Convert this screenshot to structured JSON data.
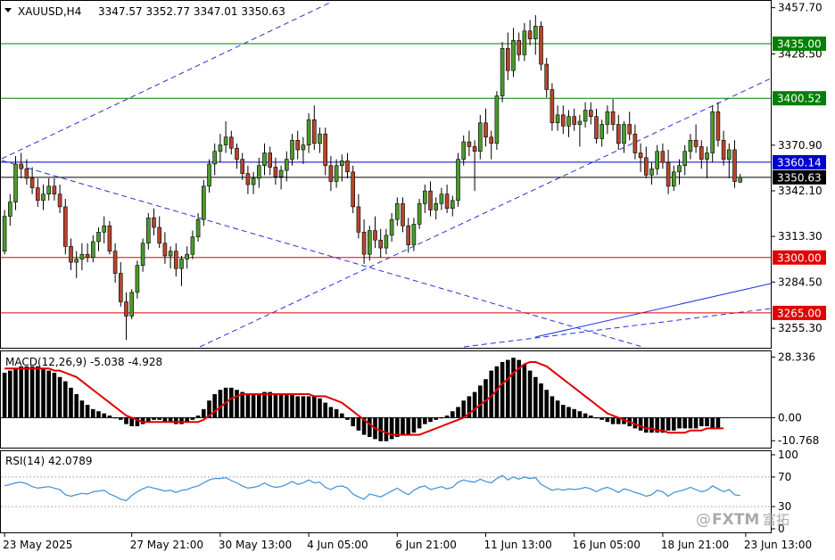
{
  "header": {
    "symbol_label": "XAUUSD,H4",
    "ohlc_label": "3347.57 3352.77 3347.01 3350.63"
  },
  "price_axis": {
    "ticks": [
      "3457.70",
      "3428.50",
      "3370.90",
      "3342.10",
      "3313.30",
      "3284.50",
      "3255.30"
    ],
    "tick_values": [
      3457.7,
      3428.5,
      3370.9,
      3342.1,
      3313.3,
      3284.5,
      3255.3
    ]
  },
  "levels": [
    {
      "label": "3435.00",
      "value": 3435.0,
      "color": "#008000"
    },
    {
      "label": "3400.52",
      "value": 3400.52,
      "color": "#008000"
    },
    {
      "label": "3360.14",
      "value": 3360.14,
      "color": "#0000cc"
    },
    {
      "label": "3350.63",
      "value": 3350.63,
      "color": "#000000"
    },
    {
      "label": "3300.00",
      "value": 3300.0,
      "color": "#e00000"
    },
    {
      "label": "3265.00",
      "value": 3265.0,
      "color": "#e00000"
    }
  ],
  "time_axis": {
    "labels": [
      "23 May 2025",
      "27 May 21:00",
      "30 May 13:00",
      "4 Jun 05:00",
      "6 Jun 21:00",
      "11 Jun 13:00",
      "16 Jun 05:00",
      "18 Jun 21:00",
      "23 Jun 13:00"
    ],
    "bar_index": [
      0,
      23,
      39,
      55,
      71,
      87,
      103,
      119,
      134
    ]
  },
  "macd": {
    "label": "MACD(12,26,9) -5.038 -4.928",
    "ticks": [
      "28.336",
      "0.00",
      "-10.768"
    ],
    "tick_values": [
      28.336,
      0.0,
      -10.768
    ]
  },
  "rsi": {
    "label": "RSI(14) 42.0789",
    "ticks": [
      "100",
      "70",
      "30",
      "0"
    ],
    "tick_values": [
      100,
      70,
      30,
      0
    ]
  },
  "watermark": {
    "text": "FXTM",
    "text_cn": "富拓"
  },
  "colors": {
    "bull": "#4b9a2c",
    "bear": "#b5462c",
    "signal": "#e00000",
    "rsi_line": "#3b8fd6",
    "trendline": "#2233dd"
  },
  "chart_data": {
    "type": "candlestick",
    "title": "XAUUSD,H4",
    "timeframe": "H4",
    "last_ohlc": {
      "open": 3347.57,
      "high": 3352.77,
      "low": 3347.01,
      "close": 3350.63
    },
    "price_range": [
      3243,
      3462
    ],
    "levels": [
      3435.0,
      3400.52,
      3360.14,
      3350.63,
      3300.0,
      3265.0
    ],
    "candles": [
      [
        3304,
        3330,
        3302,
        3326
      ],
      [
        3326,
        3340,
        3320,
        3335
      ],
      [
        3335,
        3364,
        3330,
        3359
      ],
      [
        3359,
        3366,
        3350,
        3356
      ],
      [
        3356,
        3362,
        3346,
        3350
      ],
      [
        3350,
        3357,
        3340,
        3344
      ],
      [
        3344,
        3350,
        3332,
        3336
      ],
      [
        3336,
        3346,
        3330,
        3340
      ],
      [
        3340,
        3350,
        3336,
        3345
      ],
      [
        3345,
        3350,
        3336,
        3340
      ],
      [
        3340,
        3346,
        3328,
        3332
      ],
      [
        3332,
        3337,
        3302,
        3307
      ],
      [
        3307,
        3312,
        3292,
        3297
      ],
      [
        3297,
        3304,
        3287,
        3299
      ],
      [
        3299,
        3309,
        3292,
        3302
      ],
      [
        3302,
        3309,
        3297,
        3300
      ],
      [
        3300,
        3314,
        3297,
        3310
      ],
      [
        3310,
        3319,
        3304,
        3316
      ],
      [
        3316,
        3326,
        3309,
        3320
      ],
      [
        3320,
        3323,
        3302,
        3304
      ],
      [
        3304,
        3309,
        3284,
        3290
      ],
      [
        3290,
        3297,
        3269,
        3272
      ],
      [
        3272,
        3278,
        3248,
        3263
      ],
      [
        3263,
        3280,
        3261,
        3278
      ],
      [
        3278,
        3298,
        3274,
        3295
      ],
      [
        3295,
        3312,
        3291,
        3309
      ],
      [
        3309,
        3328,
        3305,
        3325
      ],
      [
        3325,
        3331,
        3314,
        3319
      ],
      [
        3319,
        3326,
        3306,
        3309
      ],
      [
        3309,
        3316,
        3296,
        3301
      ],
      [
        3301,
        3307,
        3293,
        3304
      ],
      [
        3304,
        3309,
        3288,
        3293
      ],
      [
        3293,
        3301,
        3282,
        3299
      ],
      [
        3299,
        3307,
        3293,
        3302
      ],
      [
        3302,
        3317,
        3299,
        3313
      ],
      [
        3313,
        3328,
        3310,
        3324
      ],
      [
        3324,
        3349,
        3320,
        3345
      ],
      [
        3345,
        3362,
        3341,
        3359
      ],
      [
        3359,
        3372,
        3352,
        3367
      ],
      [
        3367,
        3378,
        3360,
        3371
      ],
      [
        3371,
        3386,
        3366,
        3376
      ],
      [
        3376,
        3380,
        3365,
        3369
      ],
      [
        3369,
        3372,
        3356,
        3362
      ],
      [
        3362,
        3366,
        3349,
        3353
      ],
      [
        3353,
        3358,
        3340,
        3346
      ],
      [
        3346,
        3354,
        3340,
        3350
      ],
      [
        3350,
        3363,
        3344,
        3358
      ],
      [
        3358,
        3372,
        3352,
        3366
      ],
      [
        3366,
        3370,
        3352,
        3357
      ],
      [
        3357,
        3363,
        3346,
        3351
      ],
      [
        3351,
        3358,
        3343,
        3355
      ],
      [
        3355,
        3367,
        3348,
        3362
      ],
      [
        3362,
        3378,
        3358,
        3374
      ],
      [
        3374,
        3380,
        3362,
        3368
      ],
      [
        3368,
        3376,
        3359,
        3371
      ],
      [
        3371,
        3391,
        3366,
        3387
      ],
      [
        3387,
        3396,
        3368,
        3372
      ],
      [
        3372,
        3382,
        3366,
        3378
      ],
      [
        3378,
        3382,
        3352,
        3358
      ],
      [
        3358,
        3364,
        3342,
        3348
      ],
      [
        3348,
        3362,
        3344,
        3358
      ],
      [
        3358,
        3365,
        3348,
        3361
      ],
      [
        3361,
        3366,
        3350,
        3354
      ],
      [
        3354,
        3358,
        3328,
        3332
      ],
      [
        3332,
        3340,
        3312,
        3316
      ],
      [
        3316,
        3324,
        3296,
        3302
      ],
      [
        3302,
        3320,
        3298,
        3317
      ],
      [
        3317,
        3326,
        3306,
        3311
      ],
      [
        3311,
        3318,
        3300,
        3306
      ],
      [
        3306,
        3318,
        3302,
        3314
      ],
      [
        3314,
        3328,
        3310,
        3324
      ],
      [
        3324,
        3338,
        3320,
        3334
      ],
      [
        3334,
        3338,
        3316,
        3320
      ],
      [
        3320,
        3325,
        3303,
        3308
      ],
      [
        3308,
        3325,
        3304,
        3321
      ],
      [
        3321,
        3337,
        3318,
        3334
      ],
      [
        3334,
        3346,
        3328,
        3342
      ],
      [
        3342,
        3348,
        3326,
        3330
      ],
      [
        3330,
        3338,
        3324,
        3334
      ],
      [
        3334,
        3344,
        3330,
        3340
      ],
      [
        3340,
        3346,
        3328,
        3331
      ],
      [
        3331,
        3339,
        3326,
        3336
      ],
      [
        3336,
        3366,
        3332,
        3362
      ],
      [
        3362,
        3377,
        3358,
        3373
      ],
      [
        3373,
        3380,
        3364,
        3370
      ],
      [
        3370,
        3374,
        3342,
        3367
      ],
      [
        3367,
        3390,
        3362,
        3385
      ],
      [
        3385,
        3394,
        3370,
        3376
      ],
      [
        3376,
        3380,
        3362,
        3372
      ],
      [
        3372,
        3405,
        3368,
        3402
      ],
      [
        3402,
        3436,
        3398,
        3432
      ],
      [
        3432,
        3442,
        3412,
        3418
      ],
      [
        3418,
        3445,
        3414,
        3437
      ],
      [
        3437,
        3442,
        3424,
        3428
      ],
      [
        3428,
        3448,
        3424,
        3443
      ],
      [
        3443,
        3450,
        3434,
        3438
      ],
      [
        3438,
        3453,
        3428,
        3446
      ],
      [
        3446,
        3449,
        3418,
        3422
      ],
      [
        3422,
        3426,
        3401,
        3406
      ],
      [
        3406,
        3410,
        3380,
        3385
      ],
      [
        3385,
        3396,
        3380,
        3390
      ],
      [
        3390,
        3396,
        3378,
        3383
      ],
      [
        3383,
        3393,
        3376,
        3389
      ],
      [
        3389,
        3394,
        3380,
        3384
      ],
      [
        3384,
        3390,
        3370,
        3386
      ],
      [
        3386,
        3398,
        3382,
        3393
      ],
      [
        3393,
        3398,
        3384,
        3389
      ],
      [
        3389,
        3394,
        3372,
        3375
      ],
      [
        3375,
        3387,
        3370,
        3384
      ],
      [
        3384,
        3396,
        3378,
        3392
      ],
      [
        3392,
        3400,
        3380,
        3384
      ],
      [
        3384,
        3390,
        3368,
        3372
      ],
      [
        3372,
        3386,
        3366,
        3384
      ],
      [
        3384,
        3392,
        3374,
        3378
      ],
      [
        3378,
        3384,
        3362,
        3366
      ],
      [
        3366,
        3372,
        3354,
        3363
      ],
      [
        3363,
        3370,
        3350,
        3352
      ],
      [
        3352,
        3360,
        3346,
        3356
      ],
      [
        3356,
        3371,
        3352,
        3367
      ],
      [
        3367,
        3372,
        3356,
        3360
      ],
      [
        3360,
        3368,
        3340,
        3345
      ],
      [
        3345,
        3358,
        3342,
        3354
      ],
      [
        3354,
        3362,
        3346,
        3358
      ],
      [
        3358,
        3371,
        3352,
        3367
      ],
      [
        3367,
        3378,
        3362,
        3374
      ],
      [
        3374,
        3384,
        3366,
        3370
      ],
      [
        3370,
        3374,
        3356,
        3362
      ],
      [
        3362,
        3370,
        3350,
        3366
      ],
      [
        3366,
        3396,
        3360,
        3392
      ],
      [
        3392,
        3398,
        3370,
        3374
      ],
      [
        3374,
        3380,
        3358,
        3362
      ],
      [
        3362,
        3372,
        3350,
        3368
      ],
      [
        3368,
        3374,
        3344,
        3348
      ],
      [
        3347.57,
        3352.77,
        3347.01,
        3350.63
      ]
    ],
    "macd_range": [
      -14,
      31
    ],
    "macd_hist": [
      21,
      22,
      23,
      24,
      24,
      24,
      24,
      23,
      22,
      21,
      19,
      17,
      14,
      11,
      8,
      6,
      4,
      3,
      2,
      1,
      0,
      -1,
      -3,
      -4,
      -4,
      -3,
      -2,
      -1,
      -1,
      -2,
      -2,
      -3,
      -3,
      -2,
      -1,
      1,
      4,
      8,
      11,
      13,
      14,
      14,
      13,
      12,
      11,
      11,
      11,
      12,
      12,
      11,
      11,
      11,
      11,
      10,
      10,
      10,
      10,
      9,
      7,
      5,
      4,
      2,
      -1,
      -4,
      -6,
      -8,
      -9,
      -10,
      -11,
      -11,
      -10,
      -9,
      -8,
      -8,
      -7,
      -5,
      -3,
      -2,
      -1,
      0,
      1,
      3,
      5,
      8,
      10,
      12,
      15,
      18,
      22,
      24,
      26,
      27,
      28,
      27,
      25,
      22,
      19,
      16,
      13,
      10,
      8,
      6,
      5,
      4,
      3,
      2,
      1,
      0,
      -1,
      -2,
      -3,
      -3,
      -3,
      -4,
      -5,
      -6,
      -7,
      -7,
      -7,
      -7,
      -6,
      -6,
      -5,
      -5,
      -5,
      -5,
      -4,
      -4,
      -5,
      -5
    ],
    "macd_signal": [
      23,
      23,
      23,
      23,
      23,
      23,
      23,
      23,
      23,
      22,
      22,
      21,
      20,
      19,
      17,
      15,
      13,
      11,
      9,
      7,
      5,
      3,
      1,
      0,
      -1,
      -2,
      -2,
      -2,
      -2,
      -2,
      -2,
      -2,
      -2,
      -2,
      -2,
      -2,
      -1,
      1,
      3,
      5,
      7,
      9,
      10,
      11,
      11,
      11,
      11,
      11,
      11,
      11,
      11,
      11,
      11,
      11,
      11,
      11,
      10,
      10,
      10,
      9,
      8,
      7,
      5,
      3,
      1,
      -1,
      -3,
      -5,
      -6,
      -7,
      -8,
      -8,
      -8,
      -8,
      -8,
      -8,
      -7,
      -6,
      -5,
      -4,
      -3,
      -2,
      -1,
      0,
      2,
      4,
      6,
      8,
      10,
      13,
      16,
      18,
      21,
      23,
      25,
      26,
      26,
      25,
      24,
      22,
      20,
      18,
      16,
      14,
      12,
      10,
      8,
      6,
      4,
      2,
      1,
      0,
      -1,
      -2,
      -3,
      -4,
      -5,
      -5,
      -6,
      -6,
      -7,
      -7,
      -7,
      -7,
      -6,
      -6,
      -6,
      -5,
      -5,
      -5,
      -5
    ],
    "rsi_range": [
      0,
      100
    ],
    "rsi": [
      58,
      60,
      62,
      63,
      61,
      57,
      55,
      56,
      57,
      55,
      53,
      46,
      44,
      46,
      48,
      47,
      50,
      51,
      52,
      47,
      44,
      40,
      38,
      45,
      50,
      54,
      57,
      55,
      53,
      51,
      52,
      49,
      52,
      53,
      56,
      58,
      62,
      66,
      68,
      68,
      69,
      65,
      62,
      58,
      55,
      56,
      58,
      62,
      58,
      56,
      57,
      60,
      64,
      60,
      62,
      66,
      62,
      63,
      56,
      53,
      57,
      58,
      55,
      47,
      43,
      40,
      47,
      45,
      43,
      47,
      51,
      55,
      50,
      46,
      52,
      56,
      58,
      53,
      55,
      57,
      54,
      56,
      63,
      66,
      64,
      63,
      67,
      64,
      62,
      68,
      72,
      66,
      70,
      67,
      70,
      68,
      69,
      60,
      56,
      52,
      54,
      52,
      54,
      53,
      54,
      56,
      54,
      50,
      54,
      56,
      53,
      49,
      54,
      52,
      49,
      47,
      44,
      46,
      52,
      50,
      44,
      49,
      51,
      53,
      56,
      53,
      50,
      52,
      58,
      54,
      50,
      53,
      46,
      45
    ]
  }
}
